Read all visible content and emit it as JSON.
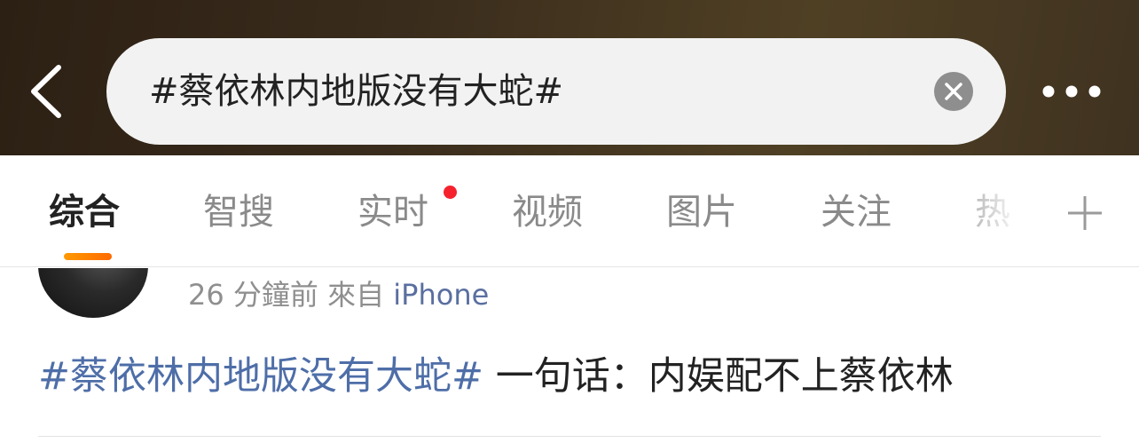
{
  "header": {
    "search_query": "#蔡依林内地版没有大蛇#",
    "icons": {
      "back": "chevron-left-icon",
      "clear": "clear-circle-icon",
      "more": "more-dots-icon"
    }
  },
  "tabs": [
    {
      "label": "综合",
      "active": true
    },
    {
      "label": "智搜"
    },
    {
      "label": "实时",
      "badge": "red-dot"
    },
    {
      "label": "视频"
    },
    {
      "label": "图片"
    },
    {
      "label": "关注"
    },
    {
      "label": "热"
    }
  ],
  "post": {
    "time": "26 分鐘前",
    "source_prefix": "來自",
    "source": "iPhone",
    "topic": "#蔡依林内地版没有大蛇#",
    "text": " 一句话：内娱配不上蔡依林"
  },
  "colors": {
    "accent": "#ff8200",
    "link": "#4e6ea8",
    "badge": "#f5222d"
  }
}
